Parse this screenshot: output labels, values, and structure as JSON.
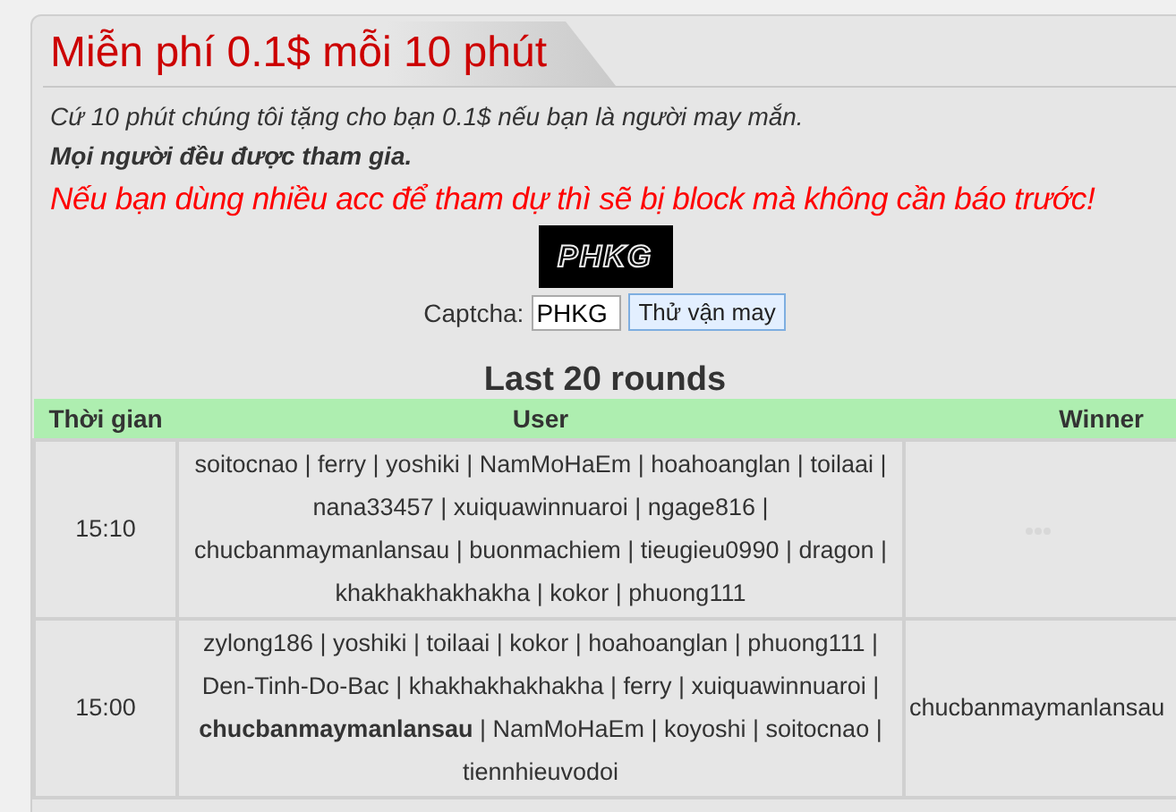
{
  "title": "Miễn phí 0.1$ mỗi 10 phút",
  "intro": "Cứ 10 phút chúng tôi tặng cho bạn 0.1$ nếu bạn là người may mắn.",
  "note": "Mọi người đều được tham gia.",
  "warning": "Nếu bạn dùng nhiều acc để tham dự thì sẽ bị block mà không cần báo trước!",
  "captcha": {
    "image_text": "PHKG",
    "label": "Captcha:",
    "value": "PHKG",
    "button": "Thử vận may"
  },
  "rounds": {
    "title": "Last 20 rounds",
    "columns": [
      "Thời gian",
      "User",
      "Winner"
    ],
    "rows": [
      {
        "time": "15:10",
        "users": "soitocnao | ferry | yoshiki | NamMoHaEm | hoahoanglan | toilaai | nana33457 | xuiquawinnuaroi | ngage816 | chucbanmaymanlansau | buonmachiem | tieugieu0990 | dragon | khakhakhakhakha | kokor | phuong111",
        "pending": true
      },
      {
        "time": "15:00",
        "users": "zylong186 | yoshiki | toilaai | kokor | hoahoanglan | phuong111 | Den-Tinh-Do-Bac | khakhakhakhakha | ferry | xuiquawinnuaroi | **chucbanmaymanlansau** | NamMoHaEm | koyoshi | soitocnao | tiennhieuvodoi",
        "winner": "chucbanmaymanlansau",
        "pending": false
      }
    ]
  }
}
